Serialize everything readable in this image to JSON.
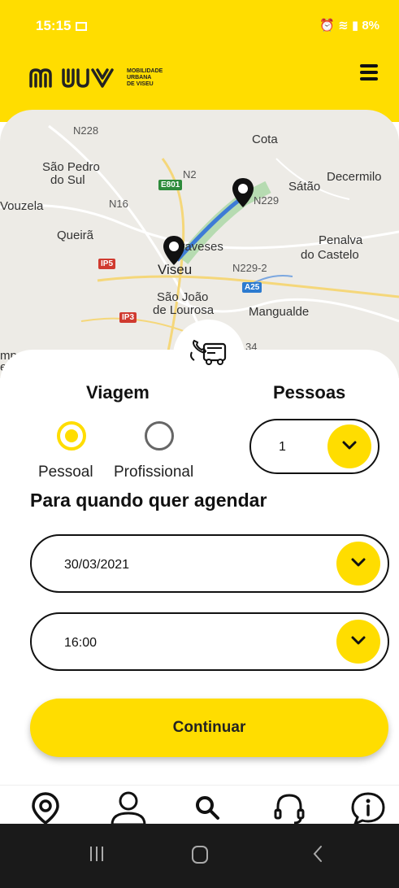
{
  "status": {
    "time": "15:15",
    "battery": "8%"
  },
  "header": {
    "logo": "MUV",
    "logo_subtitle_1": "MOBILIDADE",
    "logo_subtitle_2": "URBANA",
    "logo_subtitle_3": "DE VISEU"
  },
  "map": {
    "labels": [
      "N228",
      "Cota",
      "São Pedro",
      "do Sul",
      "N2",
      "E801",
      "Decermilo",
      "Sátão",
      "Vouzela",
      "N16",
      "N229",
      "Queirã",
      "Penalva",
      "do Castelo",
      "Abraveses",
      "IP5",
      "Viseu",
      "N229-2",
      "A25",
      "São João",
      "de Lourosa",
      "Mangualde",
      "IP3",
      "mpo de",
      "est",
      "34"
    ],
    "colors": {
      "route": "#3D7BD6",
      "badge_green": "#2E8B3C",
      "badge_red": "#D03A2F",
      "badge_blue": "#2C7BD0"
    }
  },
  "form": {
    "trip_label": "Viagem",
    "people_label": "Pessoas",
    "option_personal": "Pessoal",
    "option_professional": "Profissional",
    "people_value": "1",
    "schedule_title": "Para quando quer agendar",
    "date_value": "30/03/2021",
    "time_value": "16:00",
    "continue_label": "Continuar"
  },
  "tabs": [
    "location-icon",
    "profile-icon",
    "search-icon",
    "support-icon",
    "info-icon"
  ],
  "colors": {
    "accent": "#FFDD00",
    "text": "#111111"
  }
}
